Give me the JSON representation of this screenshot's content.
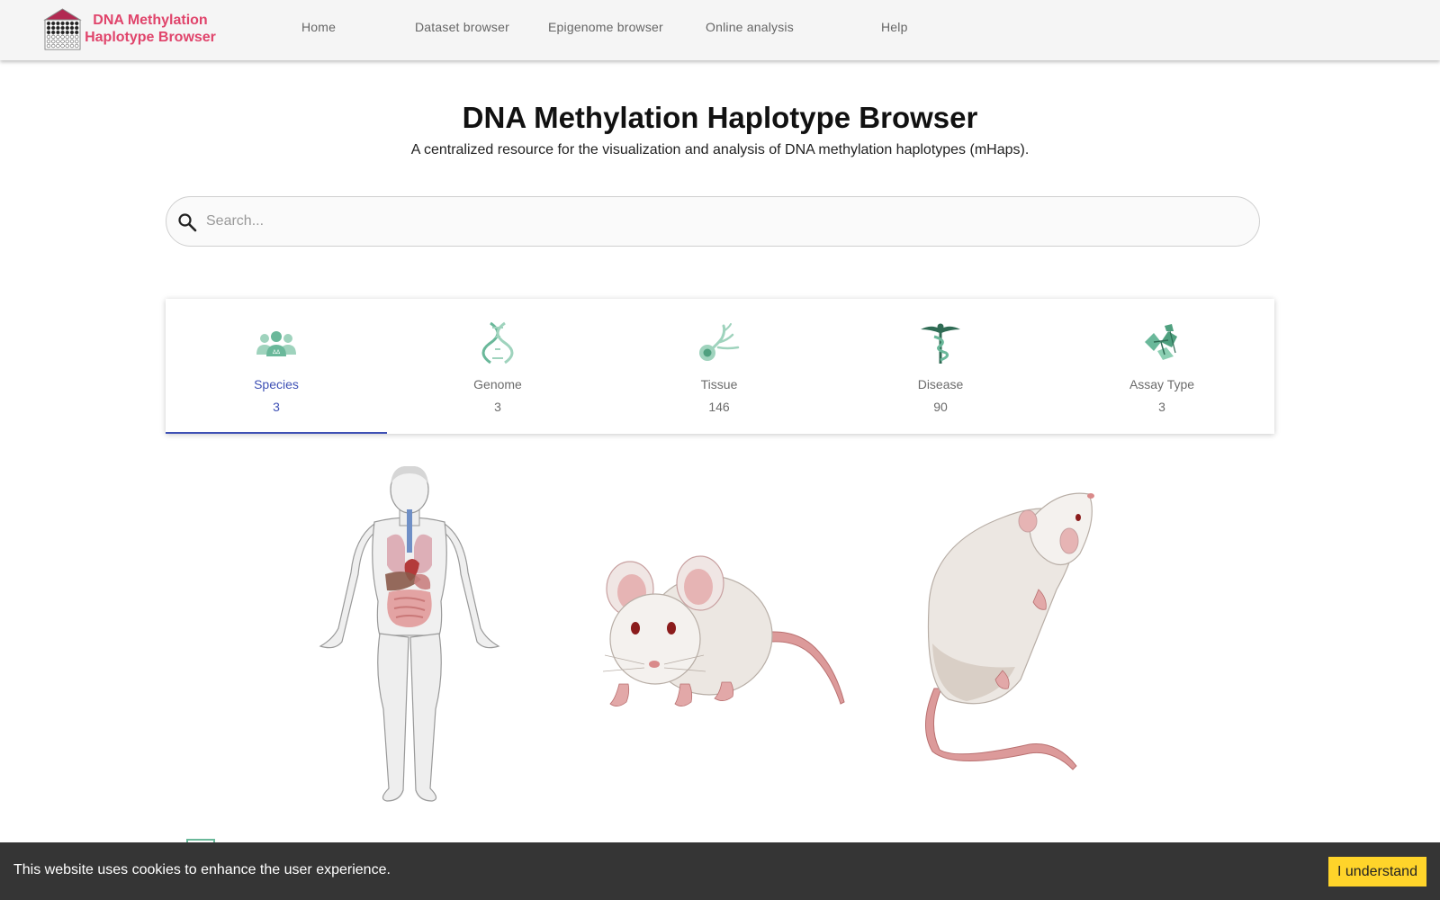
{
  "header": {
    "brand_line1": "DNA Methylation",
    "brand_line2": "Haplotype Browser",
    "brand_color": "#e0446b",
    "nav": [
      {
        "label": "Home"
      },
      {
        "label": "Dataset browser"
      },
      {
        "label": "Epigenome browser"
      },
      {
        "label": "Online analysis"
      },
      {
        "label": "Help"
      }
    ]
  },
  "hero": {
    "title": "DNA Methylation Haplotype Browser",
    "subtitle": "A centralized resource for the visualization and analysis of DNA methylation haplotypes (mHaps)."
  },
  "search": {
    "placeholder": "Search...",
    "value": "",
    "icon": "search-icon"
  },
  "stats": [
    {
      "label": "Species",
      "count": "3",
      "icon": "species-people-icon",
      "active": true
    },
    {
      "label": "Genome",
      "count": "3",
      "icon": "dna-helix-icon",
      "active": false
    },
    {
      "label": "Tissue",
      "count": "146",
      "icon": "tissue-cell-icon",
      "active": false
    },
    {
      "label": "Disease",
      "count": "90",
      "icon": "caduceus-icon",
      "active": false
    },
    {
      "label": "Assay Type",
      "count": "3",
      "icon": "assay-molecule-icon",
      "active": false
    }
  ],
  "colors": {
    "active_tab": "#3f51b5",
    "icon_green": "#6ab89a",
    "icon_dark_green": "#2f6b54",
    "cookie_bg": "#353535",
    "cookie_button": "#ffd42a"
  },
  "species_figures": [
    "human-body-illustration",
    "mouse-illustration",
    "rat-illustration"
  ],
  "cookie": {
    "text": "This website uses cookies to enhance the user experience.",
    "button": "I understand"
  }
}
